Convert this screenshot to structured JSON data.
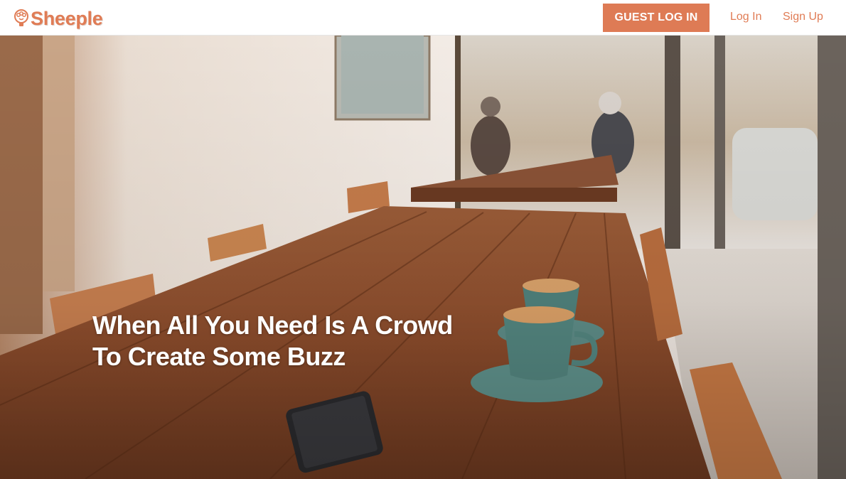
{
  "header": {
    "brand_name": "Sheeple",
    "brand_icon": "sheep-bulb-logo-icon",
    "guest_login_label": "GUEST LOG IN",
    "login_label": "Log In",
    "signup_label": "Sign Up"
  },
  "hero": {
    "headline_line1": "When All You Need Is A Crowd",
    "headline_line2": "To Create Some Buzz",
    "background": "cafe-table-coffee-cups-photo"
  },
  "colors": {
    "brand": "#e07c55",
    "button_bg": "#de7b55",
    "button_text": "#ffffff",
    "hero_text": "#ffffff"
  }
}
